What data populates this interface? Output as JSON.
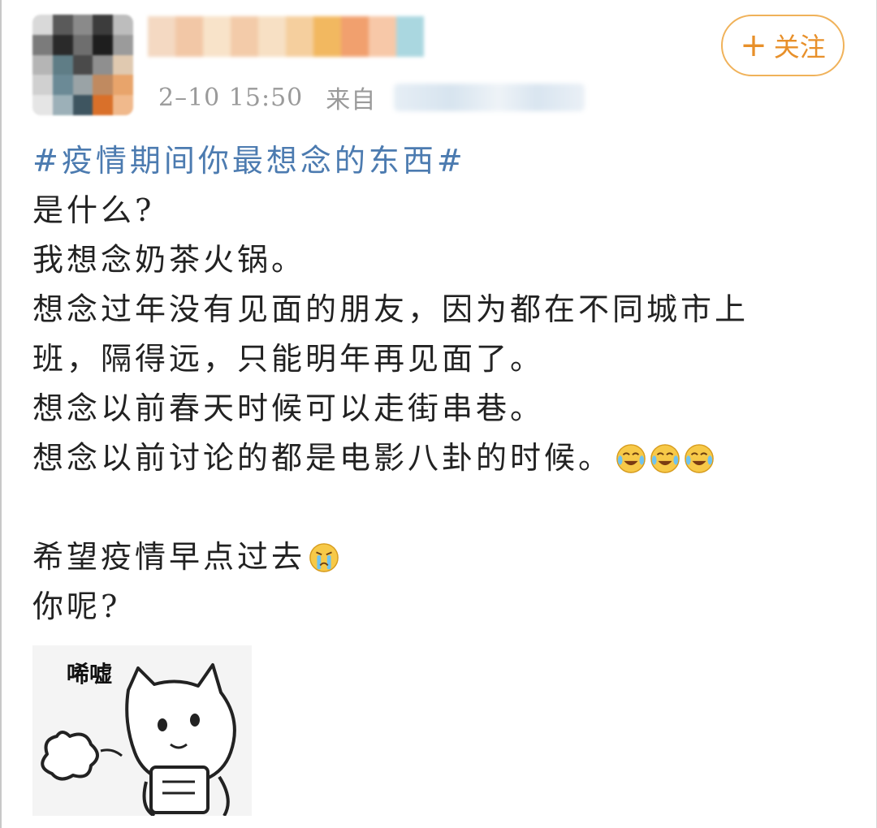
{
  "header": {
    "timestamp": "2–10 15:50",
    "from_label": "来自",
    "follow_label": "关注",
    "follow_plus": "+"
  },
  "post": {
    "hashtag": "#疫情期间你最想念的东西#",
    "lines": [
      "是什么?",
      "我想念奶茶火锅。",
      "想念过年没有见面的朋友，因为都在不同城市上",
      "班，隔得远，只能明年再见面了。",
      "想念以前春天时候可以走街串巷。",
      "想念以前讨论的都是电影八卦的时候。"
    ],
    "line_emojis": [
      "laugh-cry-icon",
      "laugh-cry-icon",
      "laugh-cry-icon"
    ],
    "closing_lines": [
      "希望疫情早点过去",
      "你呢?"
    ],
    "closing_emoji": "crying-icon"
  },
  "sticker": {
    "label": "唏嘘",
    "icon": "sighing-cat-sticker"
  },
  "colors": {
    "hashtag": "#4c7bb0",
    "follow": "#e8902a",
    "meta": "#9a9a9a"
  }
}
